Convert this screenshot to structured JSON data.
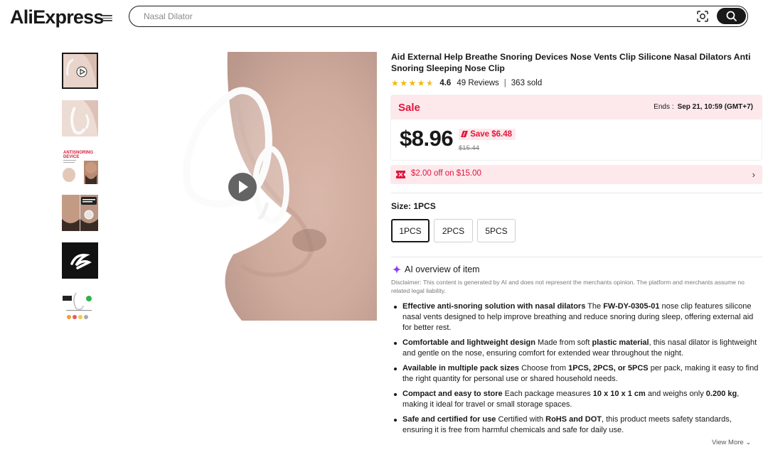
{
  "header": {
    "logo": "AliExpress",
    "search_placeholder": "Nasal Dilator"
  },
  "icons": {
    "menu": "hamburger-icon",
    "image_search": "camera-scan-icon",
    "search": "search-icon",
    "play": "play-icon",
    "sparkle": "sparkle-icon",
    "coupon": "ticket-icon",
    "chevron": "chevron-right-icon"
  },
  "gallery": {
    "thumbnails": [
      {
        "name": "thumb-video",
        "active": true
      },
      {
        "name": "thumb-clip"
      },
      {
        "name": "thumb-antisnoring"
      },
      {
        "name": "thumb-man-before-after"
      },
      {
        "name": "thumb-black-logo"
      },
      {
        "name": "thumb-infographic"
      }
    ],
    "thumb3_caption": "ANTISNORING DEVICE"
  },
  "product": {
    "title": "Aid External Help Breathe Snoring Devices Nose Vents Clip Silicone Nasal Dilators Anti Snoring Sleeping Nose Clip",
    "rating": "4.6",
    "rating_value": 4.6,
    "reviews": "49 Reviews",
    "sold": "363 sold"
  },
  "sale": {
    "label": "Sale",
    "ends_label": "Ends :",
    "ends_value": "Sep 21, 10:59 (GMT+7)",
    "price": "$8.96",
    "save": "Save $6.48",
    "original_price": "$15.44"
  },
  "coupon": {
    "text": "$2.00 off on $15.00"
  },
  "size": {
    "label": "Size: ",
    "selected": "1PCS",
    "options": [
      "1PCS",
      "2PCS",
      "5PCS"
    ]
  },
  "ai_overview": {
    "title": "AI overview of item",
    "disclaimer": "Disclaimer: This content is generated by AI and does not represent the merchants opinion. The platform and merchants assume no related legal liability.",
    "items": [
      {
        "b1": "Effective anti-snoring solution with nasal dilators",
        "t1": " The ",
        "b2": "FW-DY-0305-01",
        "t2": " nose clip features silicone nasal vents designed to help improve breathing and reduce snoring during sleep, offering external aid for better rest.",
        "b3": "",
        "t3": ""
      },
      {
        "b1": "Comfortable and lightweight design",
        "t1": " Made from soft ",
        "b2": "plastic material",
        "t2": ", this nasal dilator is lightweight and gentle on the nose, ensuring comfort for extended wear throughout the night.",
        "b3": "",
        "t3": ""
      },
      {
        "b1": "Available in multiple pack sizes",
        "t1": " Choose from ",
        "b2": "1PCS, 2PCS, or 5PCS",
        "t2": " per pack, making it easy to find the right quantity for personal use or shared household needs.",
        "b3": "",
        "t3": ""
      },
      {
        "b1": "Compact and easy to store",
        "t1": " Each package measures ",
        "b2": "10 x 10 x 1 cm",
        "t2": " and weighs only ",
        "b3": "0.200 kg",
        "t3": ", making it ideal for travel or small storage spaces."
      },
      {
        "b1": "Safe and certified for use",
        "t1": " Certified with ",
        "b2": "RoHS and DOT",
        "t2": ", this product meets safety standards, ensuring it is free from harmful chemicals and safe for daily use.",
        "b3": "",
        "t3": ""
      }
    ],
    "view_more": "View More"
  },
  "colors": {
    "brand_red": "#e1163c",
    "sale_bg": "#fde8ec",
    "star": "#f5b800",
    "text": "#191919"
  }
}
